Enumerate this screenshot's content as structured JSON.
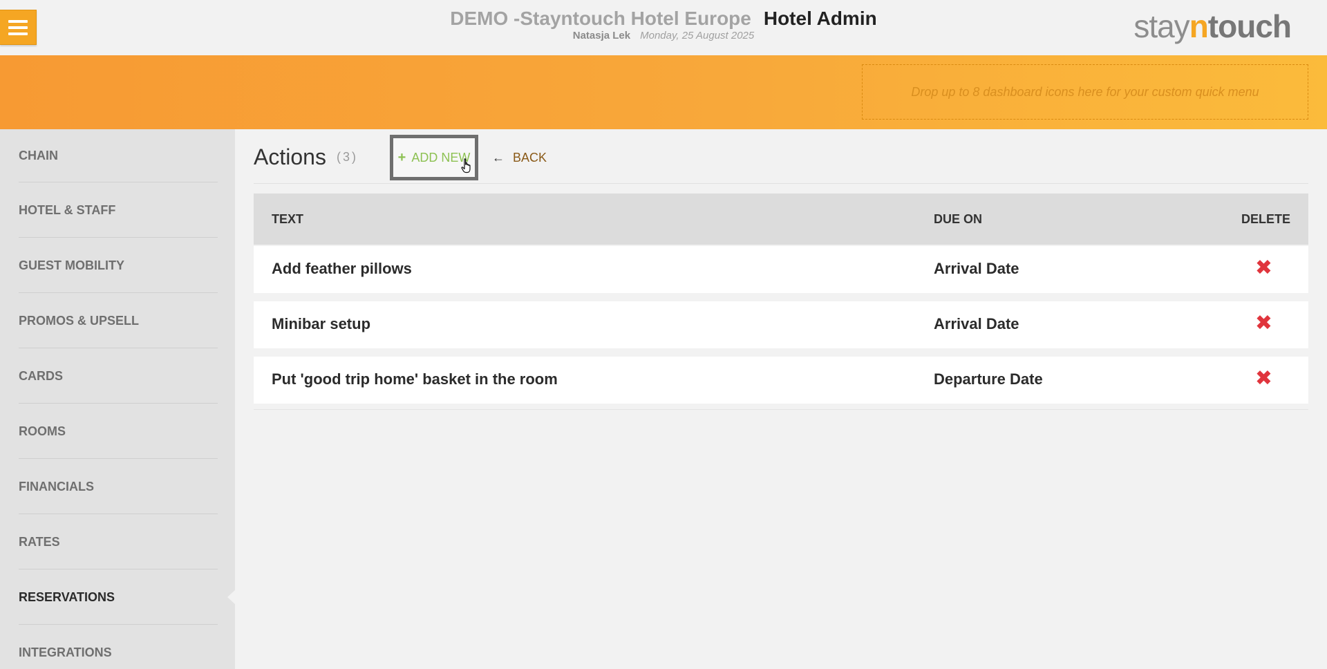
{
  "header": {
    "hotel_name": "DEMO -Stayntouch Hotel Europe",
    "app_name": "Hotel Admin",
    "user_name": "Natasja Lek",
    "date": "Monday, 25 August 2025",
    "logo": {
      "part1": "stay",
      "part2": "n",
      "part3": "touch"
    }
  },
  "banner": {
    "drop_zone_text": "Drop up to 8 dashboard icons here for your custom quick menu"
  },
  "sidebar": {
    "items": [
      {
        "label": "CHAIN"
      },
      {
        "label": "HOTEL & STAFF"
      },
      {
        "label": "GUEST MOBILITY"
      },
      {
        "label": "PROMOS & UPSELL"
      },
      {
        "label": "CARDS"
      },
      {
        "label": "ROOMS"
      },
      {
        "label": "FINANCIALS"
      },
      {
        "label": "RATES"
      },
      {
        "label": "RESERVATIONS",
        "active": true
      },
      {
        "label": "INTEGRATIONS"
      }
    ]
  },
  "main": {
    "title": "Actions",
    "count": "(3)",
    "add_new_label": "ADD NEW",
    "back_label": "BACK",
    "table": {
      "headers": {
        "text": "TEXT",
        "due_on": "DUE ON",
        "delete": "DELETE"
      },
      "rows": [
        {
          "text": "Add feather pillows",
          "due_on": "Arrival Date"
        },
        {
          "text": "Minibar setup",
          "due_on": "Arrival Date"
        },
        {
          "text": "Put 'good trip home' basket in the room",
          "due_on": "Departure Date"
        }
      ]
    }
  },
  "colors": {
    "accent_orange": "#f5a623",
    "add_green": "#8dc153",
    "delete_red": "#e0353d"
  }
}
